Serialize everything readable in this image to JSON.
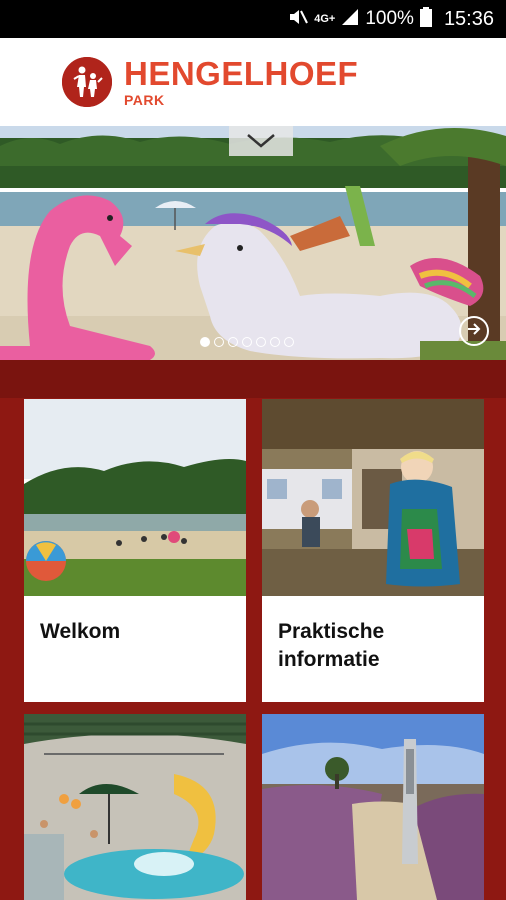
{
  "status_bar": {
    "battery": "100%",
    "time": "15:36",
    "network": "4G+",
    "icons": [
      "mute-icon",
      "network-icon",
      "signal-icon",
      "battery-icon"
    ]
  },
  "header": {
    "logo_title": "HENGELHOEF",
    "logo_subtitle": "PARK",
    "brand_color": "#e2492e"
  },
  "hero": {
    "slide_count": 7,
    "active_slide": 1,
    "icons": [
      "chevron-down-icon",
      "arrow-right-circle-icon"
    ]
  },
  "cards": [
    {
      "label": "Welkom"
    },
    {
      "label": "Praktische informatie"
    },
    {
      "label": ""
    },
    {
      "label": ""
    }
  ],
  "colors": {
    "background_red": "#8e1812",
    "card_bg": "#ffffff"
  }
}
